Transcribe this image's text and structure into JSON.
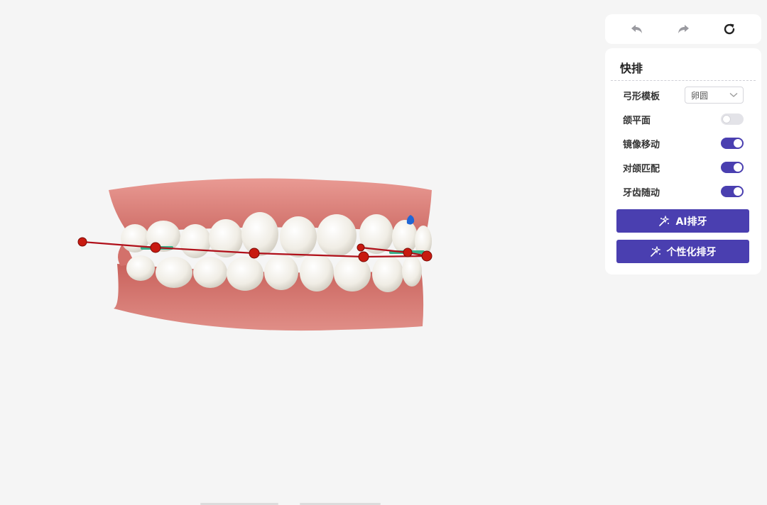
{
  "history": {
    "undo_icon": "undo-arrow-icon",
    "redo_icon": "redo-arrow-icon",
    "reset_icon": "refresh-icon"
  },
  "panel": {
    "title": "快排",
    "arch_template": {
      "label": "弓形模板",
      "value": "卵圆"
    },
    "toggles": [
      {
        "id": "jaw-plane",
        "label": "颌平面",
        "on": false
      },
      {
        "id": "mirror-move",
        "label": "镜像移动",
        "on": true
      },
      {
        "id": "opposing-match",
        "label": "对颌匹配",
        "on": true
      },
      {
        "id": "teeth-follow",
        "label": "牙齿随动",
        "on": true
      }
    ],
    "ai_button": "AI排牙",
    "custom_button": "个性化排牙"
  },
  "colors": {
    "accent": "#4a3fb0",
    "arch_line": "#b0101a",
    "landmark": "#c81a10",
    "gum": "#d97872",
    "tooth": "#f1eee6",
    "marker_blue": "#1f66d6"
  }
}
